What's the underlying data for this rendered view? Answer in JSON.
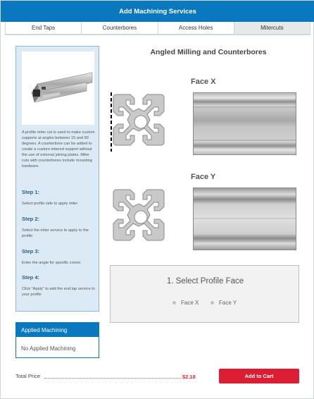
{
  "header": {
    "title": "Add Machining Services"
  },
  "tabs": [
    {
      "label": "End Taps"
    },
    {
      "label": "Counterbores"
    },
    {
      "label": "Access Holes"
    },
    {
      "label": "Mitercuts",
      "active": true
    }
  ],
  "info": {
    "description": "A profile miter cut is used to make custom supports at angles between 15 and 90 degrees. A counterbore can be added to create a custom mitered support without the use of external joining plates. Miter cuts with counterbores include mounting hardware.",
    "steps": [
      {
        "heading": "Step 1:",
        "text": "Select profile side to apply miter"
      },
      {
        "heading": "Step 2:",
        "text": "Select the miter service to apply to the profile"
      },
      {
        "heading": "Step 3:",
        "text": "Enter the angle for specific corner"
      },
      {
        "heading": "Step 4:",
        "text": "Click \"Apply\" to add the end tap service to your profile"
      }
    ]
  },
  "main": {
    "title": "Angled Milling and Counterbores",
    "faces": [
      {
        "label": "Face X"
      },
      {
        "label": "Face Y"
      }
    ]
  },
  "select": {
    "title": "1. Select Profile Face",
    "options": [
      {
        "label": "Face X"
      },
      {
        "label": "Face Y"
      }
    ]
  },
  "applied": {
    "title": "Applied Machining",
    "empty_text": "No Applied Machining"
  },
  "footer": {
    "total_label": "Total Price",
    "total_value": "$2.18",
    "cart_label": "Add to Cart"
  },
  "colors": {
    "brand_blue": "#0a78bf",
    "cart_red": "#dc1e35",
    "price_red": "#e0282e",
    "panel_blue": "#dceaf5"
  }
}
